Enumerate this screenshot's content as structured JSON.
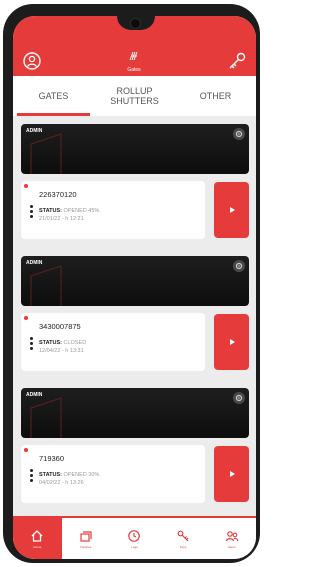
{
  "header": {
    "title": "Gates"
  },
  "tabs": [
    {
      "label": "GATES",
      "active": true
    },
    {
      "label": "ROLLUP SHUTTERS",
      "active": false
    },
    {
      "label": "OTHER",
      "active": false
    }
  ],
  "groups": [
    {
      "banner_label": "ADMIN",
      "device_id": "226370120",
      "status_label": "STATUS:",
      "status_value": "OPENED 45%",
      "timestamp": "21/01/22 - h 12:21"
    },
    {
      "banner_label": "ADMIN",
      "device_id": "3430007875",
      "status_label": "STATUS:",
      "status_value": "CLOSED",
      "timestamp": "12/04/22 - h 13:31"
    },
    {
      "banner_label": "ADMIN",
      "device_id": "719360",
      "status_label": "STATUS:",
      "status_value": "OPENED 30%",
      "timestamp": "04/02/22 - h 13:26"
    }
  ],
  "nav": [
    {
      "icon": "home-icon",
      "label": "Home",
      "active": true
    },
    {
      "icon": "devices-icon",
      "label": "Devices",
      "active": false
    },
    {
      "icon": "clock-icon",
      "label": "Logs",
      "active": false
    },
    {
      "icon": "key-icon",
      "label": "Keys",
      "active": false
    },
    {
      "icon": "users-icon",
      "label": "Users",
      "active": false
    }
  ],
  "colors": {
    "accent": "#e53b3b",
    "banner": "#141414",
    "background": "#ececec"
  }
}
